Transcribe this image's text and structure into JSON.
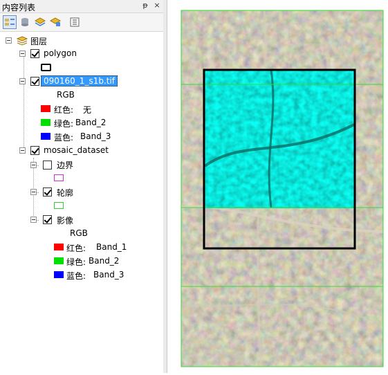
{
  "toc": {
    "title": "内容列表",
    "pin_glyph": "ᵽ",
    "close_glyph": "×",
    "tools": [
      {
        "name": "list-by-drawing-order-icon",
        "active": true
      },
      {
        "name": "list-by-source-icon",
        "active": false
      },
      {
        "name": "list-by-visibility-icon",
        "active": false
      },
      {
        "name": "list-by-selection-icon",
        "active": false
      },
      {
        "name": "options-icon",
        "active": false
      }
    ],
    "root_label": "图层",
    "layers": {
      "polygon": {
        "label": "polygon",
        "checked": true,
        "symbol_color": "#000000"
      },
      "raster": {
        "label": "090160_1_s1b.tif",
        "checked": true,
        "mode": "RGB",
        "bands": [
          {
            "channel": "红色:",
            "band": "无",
            "color": "#ff0000"
          },
          {
            "channel": "绿色:",
            "band": "Band_2",
            "color": "#00e000"
          },
          {
            "channel": "蓝色:",
            "band": "Band_3",
            "color": "#0000ff"
          }
        ]
      },
      "mosaic": {
        "label": "mosaic_dataset",
        "checked": true,
        "sublayers": {
          "boundary": {
            "label": "边界",
            "checked": false,
            "symbol_color": "#cc33cc"
          },
          "footprint": {
            "label": "轮廓",
            "checked": true,
            "symbol_color": "#33cc33"
          },
          "image": {
            "label": "影像",
            "checked": true,
            "mode": "RGB",
            "bands": [
              {
                "channel": "红色:",
                "band": "Band_1",
                "color": "#ff0000"
              },
              {
                "channel": "绿色:",
                "band": "Band_2",
                "color": "#00e000"
              },
              {
                "channel": "蓝色:",
                "band": "Band_3",
                "color": "#0000ff"
              }
            ]
          }
        }
      }
    }
  },
  "map": {
    "footprint_color": "#33dd33",
    "polygon_color": "#000000",
    "highlight_color": "#00e0d0",
    "aerial_base": "#8a8772"
  }
}
